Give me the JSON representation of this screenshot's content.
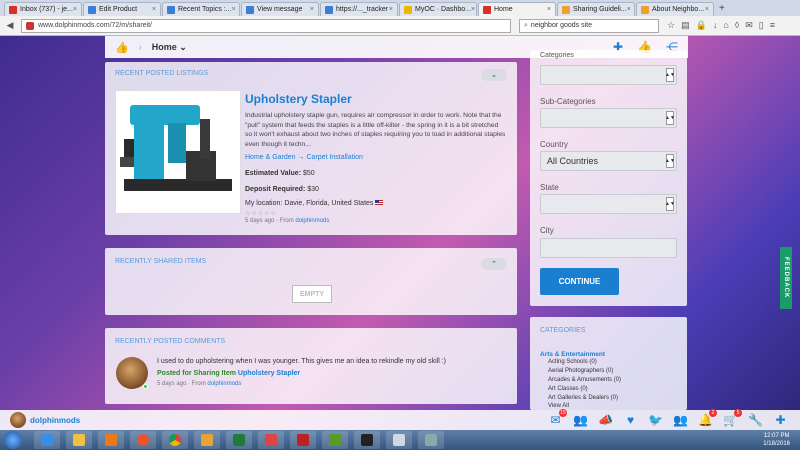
{
  "browser": {
    "tabs": [
      {
        "label": "Inbox (737) - je...",
        "color": "#d93025",
        "active": false
      },
      {
        "label": "Edit Product",
        "color": "#3b7ed8",
        "active": false
      },
      {
        "label": "Recent Topics :...",
        "color": "#3b7ed8",
        "active": false
      },
      {
        "label": "View message",
        "color": "#3b7ed8",
        "active": false
      },
      {
        "label": "https://..._tracker",
        "color": "#3b7ed8",
        "active": false
      },
      {
        "label": "MyOC · Dashbo...",
        "color": "#f0b400",
        "active": false
      },
      {
        "label": "Home",
        "color": "#d93025",
        "active": true
      },
      {
        "label": "Sharing Guideli...",
        "color": "#f0a030",
        "active": false
      },
      {
        "label": "About Neighbo...",
        "color": "#f0a030",
        "active": false
      }
    ],
    "url": "www.dolphinmods.com/72/m/shareit/",
    "search_value": "neighbor goods site"
  },
  "site_header": {
    "breadcrumb_home": "Home"
  },
  "recent_listings": {
    "title": "RECENT POSTED LISTINGS",
    "item": {
      "title": "Upholstery Stapler",
      "description": "Industrial upholstery staple gun, requires air compressor in order to work. Note that the \"pull\" system that feeds the staples is a little off-kilter - the spring in it is a bit stretched so it won't exhaust about two inches of staples requiring you to load in additional staples even though it techn...",
      "category": "Home & Garden",
      "subcategory": "Carpet Installation",
      "estimated_label": "Estimated Value:",
      "estimated_value": "$50",
      "deposit_label": "Deposit Required:",
      "deposit_value": "$30",
      "location_label": "My location:",
      "location_value": "Davie, Florida, United States",
      "stars": "☆☆☆☆☆",
      "age": "5 days ago · From",
      "author": "dolphinmods"
    }
  },
  "recent_shared": {
    "title": "RECENTLY SHARED ITEMS",
    "empty_label": "EMPTY"
  },
  "recent_comments": {
    "title": "RECENTLY POSTED COMMENTS",
    "comment": {
      "text": "I used to do upholstering when I was younger. This gives me an idea to rekindle my old skill :)",
      "posted_for": "Posted for Sharing Item",
      "item_link": "Upholstery Stapler",
      "age": "5 days ago · From",
      "author": "dolphinmods"
    }
  },
  "filters": {
    "categories_label": "Categories",
    "subcategories_label": "Sub-Categories",
    "country_label": "Country",
    "country_value": "All Countries",
    "state_label": "State",
    "city_label": "City",
    "continue_label": "CONTINUE"
  },
  "categories_panel": {
    "title": "CATEGORIES",
    "head": "Arts & Entertainment",
    "items": [
      "Acting Schools (0)",
      "Aerial Photographers (0)",
      "Arcades & Amusements (0)",
      "Art Classes (0)",
      "Art Galleries & Dealers (0)"
    ],
    "view_all": "View All"
  },
  "feedback_label": "FEEDBACK",
  "bottom_bar": {
    "username": "dolphinmods",
    "mail_badge": "15",
    "bell_badge": "2",
    "cart_badge": "5"
  },
  "taskbar": {
    "time": "12:07 PM",
    "date": "1/18/2016"
  },
  "colors": {
    "accent": "#1b7fd1",
    "continue_bg": "#1b7fd1",
    "feedback_bg": "#1a9b6a",
    "online": "#33cc33"
  }
}
